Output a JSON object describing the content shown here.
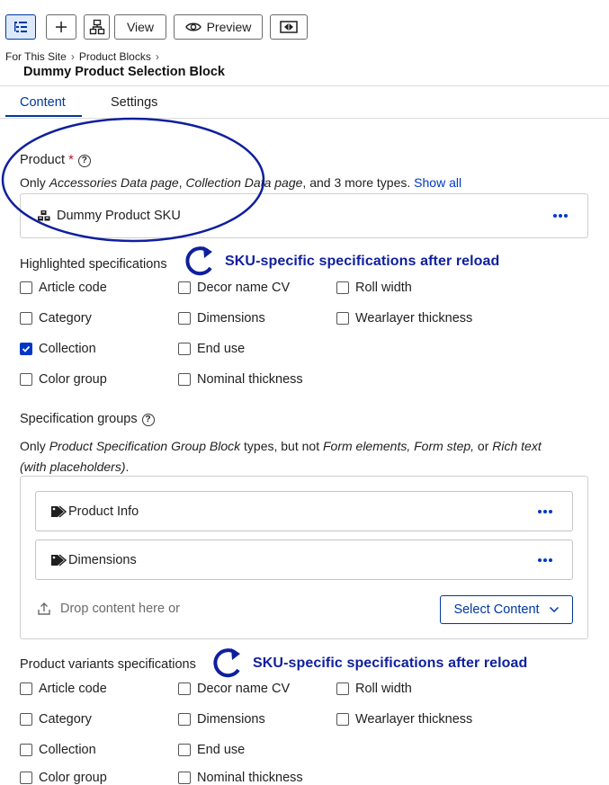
{
  "toolbar": {
    "view_label": "View",
    "preview_label": "Preview"
  },
  "breadcrumb": {
    "items": [
      "For This Site",
      "Product Blocks"
    ]
  },
  "page_title": "Dummy Product Selection Block",
  "tabs": [
    {
      "label": "Content",
      "active": true
    },
    {
      "label": "Settings",
      "active": false
    }
  ],
  "product": {
    "label": "Product",
    "required_mark": "*",
    "note_prefix": "Only ",
    "note_type_1": "Accessories Data page",
    "note_sep": ", ",
    "note_type_2": "Collection Data page",
    "note_suffix": ", and 3 more types. ",
    "show_all": "Show all",
    "selected_item": "Dummy Product SKU"
  },
  "highlighted": {
    "label": "Highlighted specifications",
    "annotation": "SKU-specific specifications after reload",
    "options": [
      {
        "label": "Article code",
        "checked": false
      },
      {
        "label": "Category",
        "checked": false
      },
      {
        "label": "Collection",
        "checked": true
      },
      {
        "label": "Color group",
        "checked": false
      },
      {
        "label": "Decor name CV",
        "checked": false
      },
      {
        "label": "Dimensions",
        "checked": false
      },
      {
        "label": "End use",
        "checked": false
      },
      {
        "label": "Nominal thickness",
        "checked": false
      },
      {
        "label": "Roll width",
        "checked": false
      },
      {
        "label": "Wearlayer thickness",
        "checked": false
      }
    ]
  },
  "spec_groups": {
    "label": "Specification groups",
    "note_prefix": "Only ",
    "note_type": "Product Specification Group Block",
    "note_mid": " types, but not ",
    "note_excluded": "Form elements, Form step,",
    "note_or": " or ",
    "note_rich": "Rich text",
    "note_rich_2": "(with placeholders)",
    "note_end": ".",
    "items": [
      "Product Info",
      "Dimensions"
    ],
    "drop_text": "Drop content here or",
    "select_label": "Select Content"
  },
  "variants": {
    "label": "Product variants specifications",
    "annotation": "SKU-specific specifications after reload",
    "options": [
      {
        "label": "Article code",
        "checked": false
      },
      {
        "label": "Category",
        "checked": false
      },
      {
        "label": "Collection",
        "checked": false
      },
      {
        "label": "Color group",
        "checked": false
      },
      {
        "label": "Decor name CV",
        "checked": false
      },
      {
        "label": "Dimensions",
        "checked": false
      },
      {
        "label": "End use",
        "checked": false
      },
      {
        "label": "Nominal thickness",
        "checked": false
      },
      {
        "label": "Roll width",
        "checked": false
      },
      {
        "label": "Wearlayer thickness",
        "checked": false
      }
    ]
  },
  "colors": {
    "accent": "#0037c8",
    "annotation": "#0f1f9e",
    "required": "#c4162a"
  }
}
